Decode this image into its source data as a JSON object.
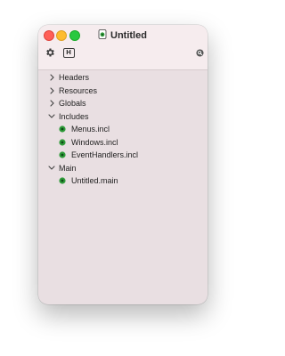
{
  "window": {
    "title": "Untitled",
    "colors": {
      "close": "#ff5f57",
      "minimize": "#febc2e",
      "zoom": "#28c840",
      "file_icon": "#2f9b3a"
    }
  },
  "toolbar": {
    "gear_icon": "gear-icon",
    "header_button_label": "H",
    "search_icon": "search-icon"
  },
  "tree": {
    "groups": [
      {
        "label": "Headers",
        "expanded": false
      },
      {
        "label": "Resources",
        "expanded": false
      },
      {
        "label": "Globals",
        "expanded": false
      },
      {
        "label": "Includes",
        "expanded": true,
        "children": [
          "Menus.incl",
          "Windows.incl",
          "EventHandlers.incl"
        ]
      },
      {
        "label": "Main",
        "expanded": true,
        "children": [
          "Untitled.main"
        ]
      }
    ]
  }
}
